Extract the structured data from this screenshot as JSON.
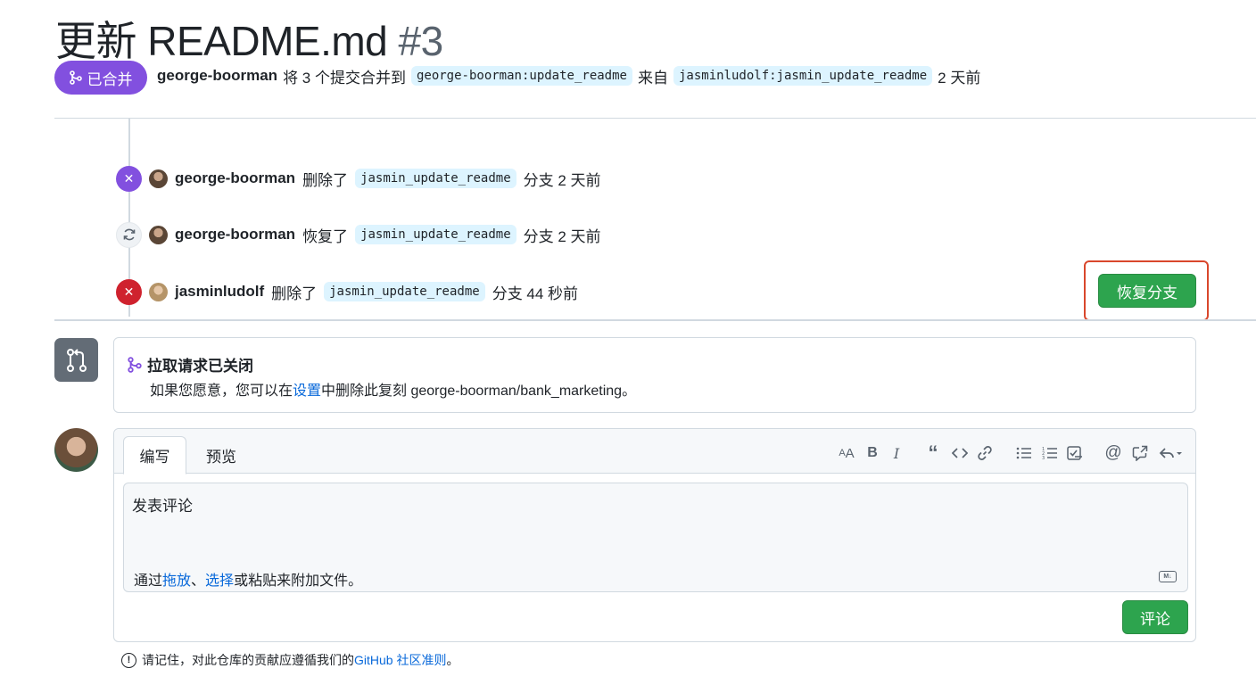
{
  "header": {
    "title": "更新 README.md",
    "number": "#3",
    "status_badge": "已合并",
    "meta": {
      "author": "george-boorman",
      "text_merged": "将 3 个提交合并到",
      "base_branch": "george-boorman:update_readme",
      "text_from": "来自",
      "head_branch": "jasminludolf:jasmin_update_readme",
      "time": "2 天前"
    }
  },
  "timeline": [
    {
      "actor": "george-boorman",
      "action": "删除了",
      "branch": "jasmin_update_readme",
      "suffix": "分支 2 天前",
      "icon": "close-icon"
    },
    {
      "actor": "george-boorman",
      "action": "恢复了",
      "branch": "jasmin_update_readme",
      "suffix": "分支 2 天前",
      "icon": "sync-icon"
    },
    {
      "actor": "jasminludolf",
      "action": "删除了",
      "branch": "jasmin_update_readme",
      "suffix": "分支 44 秒前",
      "icon": "close-icon"
    }
  ],
  "restore_button": "恢复分支",
  "closed_notice": {
    "title": "拉取请求已关闭",
    "desc_before": "如果您愿意，您可以在",
    "desc_link": "设置",
    "desc_after": "中删除此复刻 george-boorman/bank_marketing。"
  },
  "editor": {
    "tab_write": "编写",
    "tab_preview": "预览",
    "placeholder": "发表评论",
    "attach_before": "通过",
    "attach_link1": "拖放",
    "attach_sep": "、",
    "attach_link2": "选择",
    "attach_after": "或粘贴来附加文件。",
    "toolbar_icons": [
      "text-size-icon",
      "bold-icon",
      "italic-icon",
      "quote-icon",
      "code-icon",
      "link-icon",
      "unordered-list-icon",
      "ordered-list-icon",
      "tasklist-icon",
      "mention-icon",
      "cross-reference-icon",
      "saved-replies-icon"
    ],
    "comment_button": "评论"
  },
  "footnote": {
    "before": "请记住，对此仓库的贡献应遵循我们的",
    "link": "GitHub 社区准则",
    "after": "。"
  },
  "colors": {
    "merged_purple": "#8250df",
    "closed_red": "#cf222e",
    "primary_green": "#2da44e",
    "link_blue": "#0969da",
    "highlight_red": "#d9472c"
  }
}
